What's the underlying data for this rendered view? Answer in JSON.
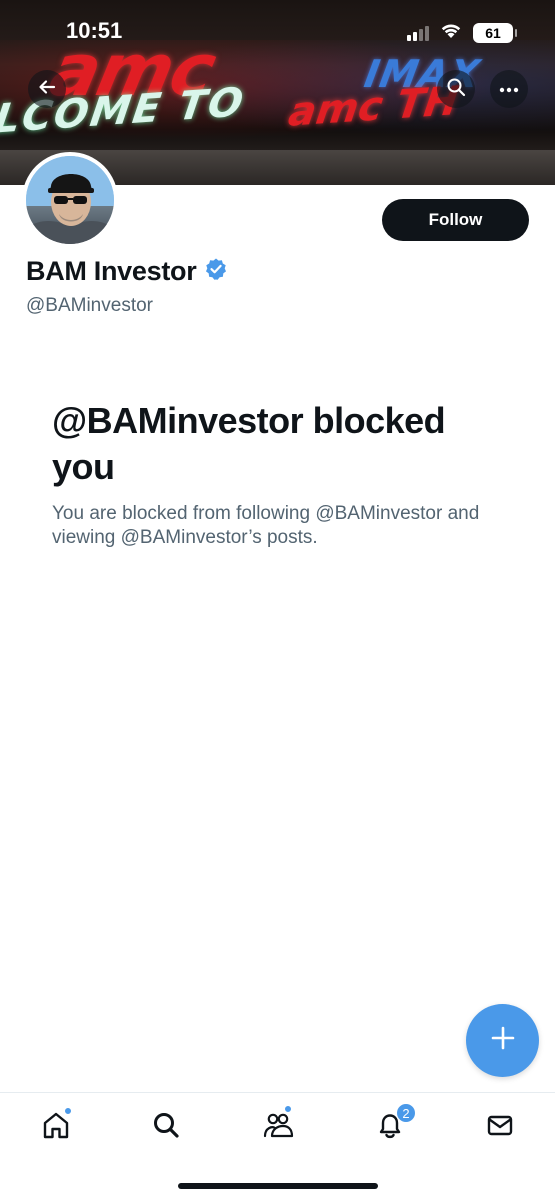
{
  "status_bar": {
    "time": "10:51",
    "battery": "61"
  },
  "banner": {
    "sign_amc": "amc",
    "sign_imax": "IMAX",
    "sign_welcome": "LCOME TO",
    "sign_welcome_amc": "amc TH"
  },
  "profile": {
    "display_name": "BAM Investor",
    "handle": "@BAMinvestor",
    "verified": true,
    "follow_label": "Follow"
  },
  "blocked": {
    "title": "@BAMinvestor blocked you",
    "description": "You are blocked from following @BAMinvestor and viewing @BAMinvestor’s posts."
  },
  "notifications_badge": "2",
  "colors": {
    "accent": "#4a99e9",
    "text": "#0f1419",
    "secondary_text": "#536471"
  },
  "icons": [
    "back-icon",
    "search-icon",
    "more-icon",
    "verified-icon",
    "plus-icon",
    "home-icon",
    "communities-icon",
    "bell-icon",
    "mail-icon"
  ]
}
